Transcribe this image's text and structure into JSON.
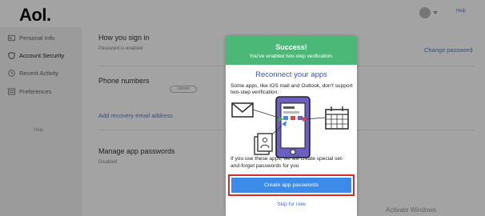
{
  "header": {
    "logo": "Aol.",
    "help_label": "Help"
  },
  "sidebar": {
    "items": [
      {
        "label": "Personal Info",
        "icon": "id-card-icon"
      },
      {
        "label": "Account Security",
        "icon": "shield-icon"
      },
      {
        "label": "Recent Activity",
        "icon": "clock-icon"
      },
      {
        "label": "Preferences",
        "icon": "list-icon"
      }
    ],
    "bottom_text": "Help"
  },
  "main": {
    "sign_in": {
      "title": "How you sign in",
      "subtitle": "Password is enabled",
      "action": "Change password"
    },
    "phone": {
      "title": "Phone numbers",
      "action_pill": "Update",
      "add_recovery": "Add recovery email address"
    },
    "app_passwords": {
      "title": "Manage app passwords",
      "subtitle": "Disabled"
    }
  },
  "watermark": "Activate Windows",
  "modal": {
    "success_title": "Success!",
    "success_subtitle": "You've enabled two-step verification.",
    "reconnect_title": "Reconnect your apps",
    "reconnect_body": "Some apps, like iOS mail and Outlook, don't support two-step verification.",
    "lower_text": "If you use these apps, we will create special set-and-forget passwords for you",
    "create_button": "Create app passwords",
    "skip_link": "Skip for now"
  },
  "colors": {
    "success_green": "#4cb878",
    "primary_blue": "#3d8be8",
    "heading_blue": "#3a4fc0",
    "highlight_red": "#d62b2b",
    "phone_purple": "#6b5fc1"
  }
}
